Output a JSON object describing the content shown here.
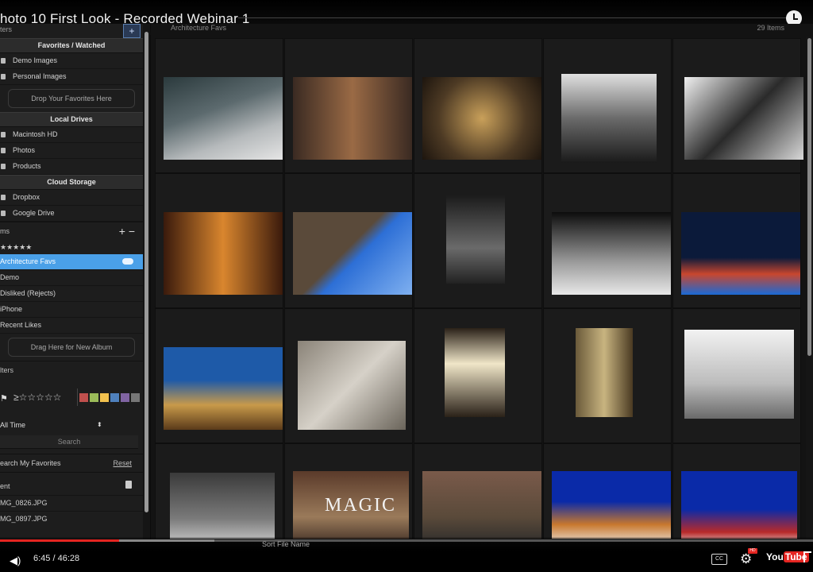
{
  "video": {
    "title": "hoto 10 First Look - Recorded Webinar 1",
    "time": "6:45 / 46:28",
    "progress_fraction": 0.146,
    "cc_label": "CC",
    "hd_badge": "HD",
    "youtube_label_a": "You",
    "youtube_label_b": "Tube"
  },
  "sidebar": {
    "top_label": "ters",
    "sections": {
      "favorites": "Favorites / Watched",
      "local": "Local Drives",
      "cloud": "Cloud Storage"
    },
    "favorites": [
      "Demo Images",
      "Personal Images"
    ],
    "drop_favorites": "Drop Your Favorites Here",
    "local_drives": [
      "Macintosh HD",
      "Photos",
      "Products"
    ],
    "cloud": [
      "Dropbox",
      "Google Drive"
    ],
    "albums_head": "ms",
    "albums_buttons": "+  −",
    "stars_label": "★★★★★",
    "albums": [
      "Architecture Favs",
      "Demo",
      "Disliked (Rejects)",
      "iPhone",
      "Recent Likes"
    ],
    "drag_album": "Drag Here for New Album",
    "filters_head": "lters",
    "filter_ratings": "≥☆☆☆☆☆",
    "swatch_colors": [
      "#c0504d",
      "#9bbb59",
      "#f2c14e",
      "#4f81bd",
      "#8064a2",
      "#777777"
    ],
    "time_select": "All Time",
    "search_btn": "Search",
    "search_favorites": "earch My Favorites",
    "reset": "Reset",
    "recent_head": "ent",
    "recent_files": [
      "MG_0826.JPG",
      "MG_0897.JPG"
    ]
  },
  "main": {
    "breadcrumb": "Architecture Favs",
    "count": "29 Items",
    "sort_label": "Sort",
    "sort_value": "File Name"
  }
}
